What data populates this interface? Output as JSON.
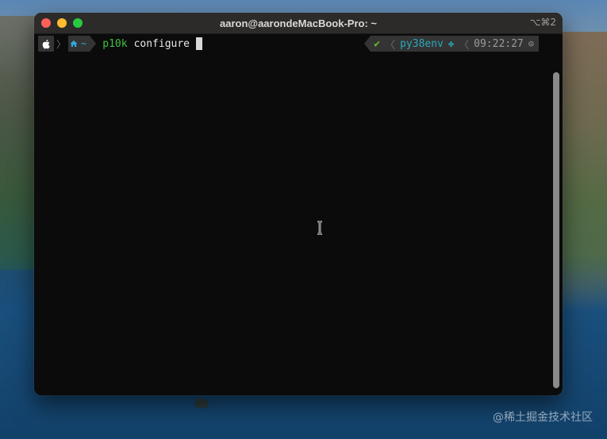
{
  "window": {
    "title": "aaron@aarondeMacBook-Pro: ~",
    "shortcut": "⌥⌘2"
  },
  "prompt": {
    "os_icon": "apple-icon",
    "dir_icon": "home-icon",
    "dir": "~",
    "command": "p10k",
    "argument": "configure",
    "status_mark": "✔",
    "env": "py38env",
    "time": "09:22:27"
  },
  "colors": {
    "command": "#3ec43e",
    "env": "#2aa9b8",
    "ok": "#5fbf2a",
    "dir": "#2fa7e0"
  },
  "watermark": "@稀土掘金技术社区"
}
